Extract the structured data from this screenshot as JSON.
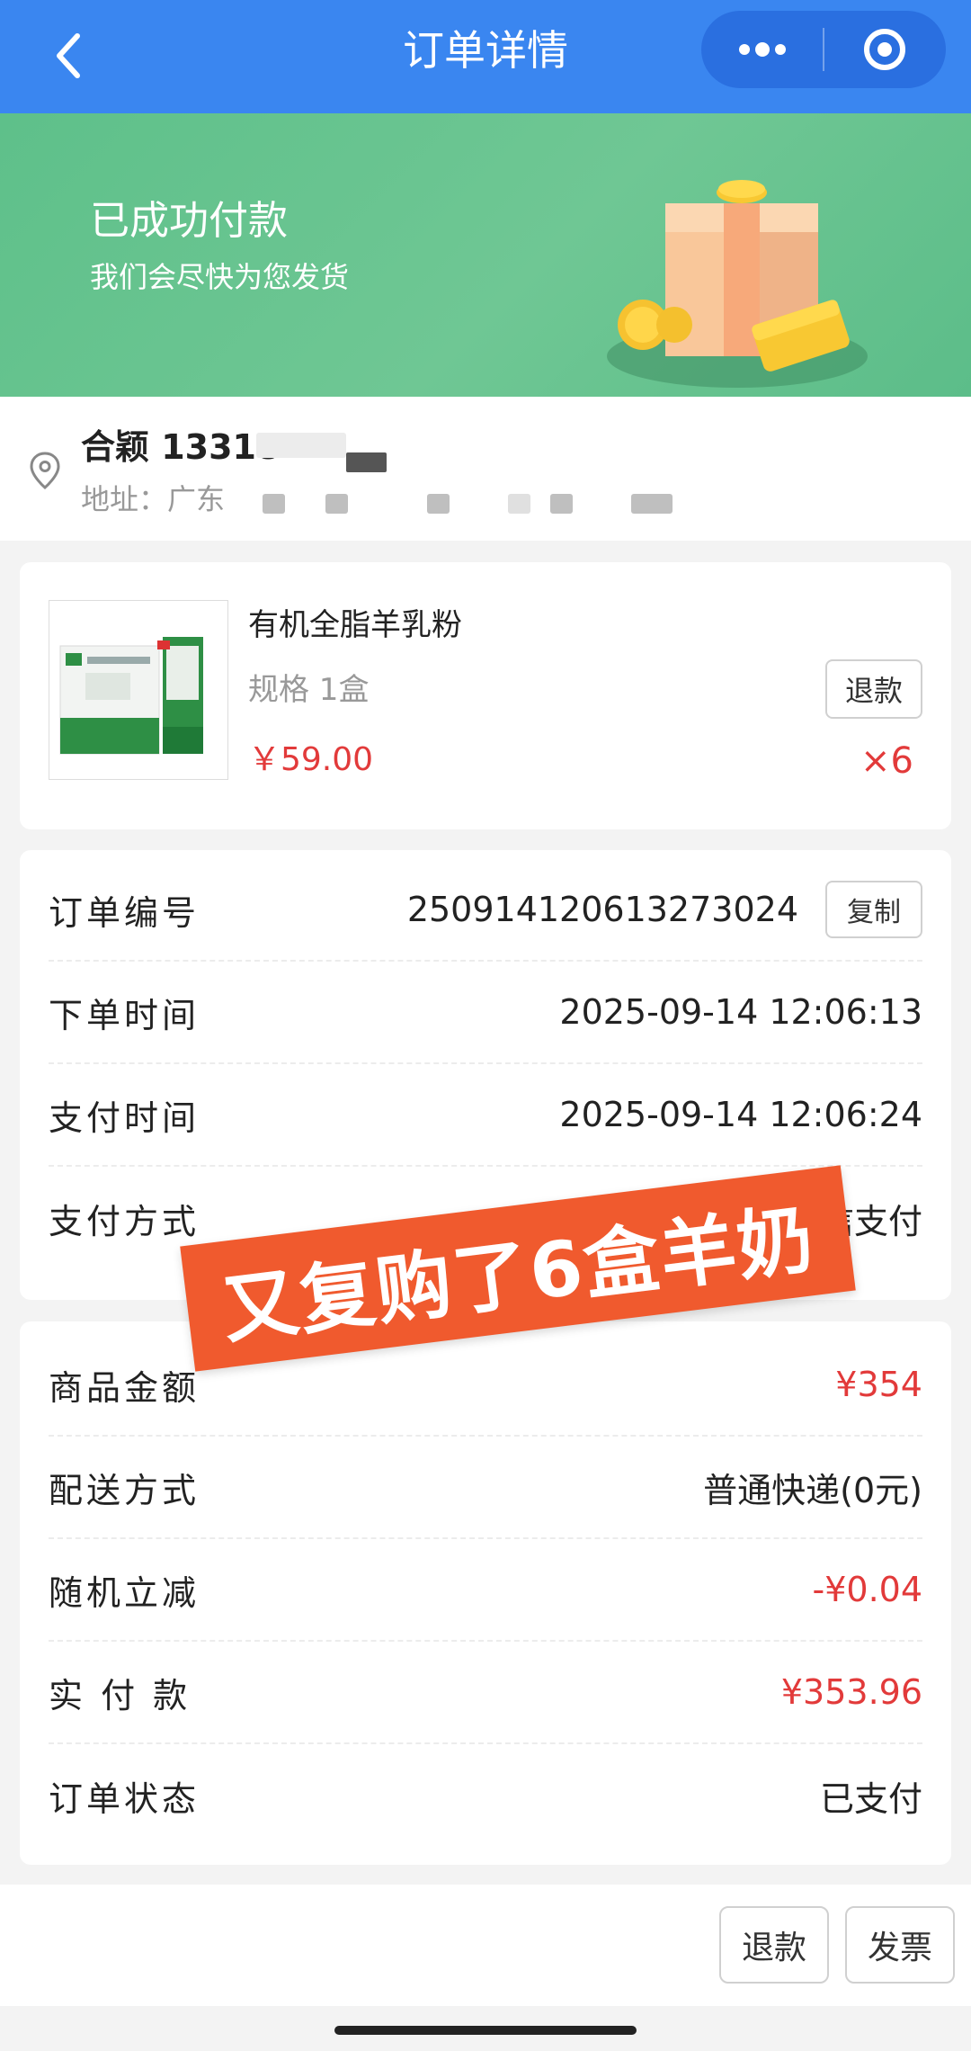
{
  "header": {
    "title": "订单详情"
  },
  "banner": {
    "title": "已成功付款",
    "subtitle": "我们会尽快为您发货"
  },
  "address": {
    "name": "合颖 13318",
    "line": "地址：广东"
  },
  "product": {
    "name": "有机全脂羊乳粉",
    "spec": "规格 1盒",
    "price": "￥59.00",
    "refund_label": "退款",
    "quantity": "×6"
  },
  "order_info": [
    {
      "label": "订单编号",
      "value": "250914120613273024",
      "action": "复制"
    },
    {
      "label": "下单时间",
      "value": "2025-09-14 12:06:13"
    },
    {
      "label": "支付时间",
      "value": "2025-09-14 12:06:24"
    },
    {
      "label": "支付方式",
      "value": "信支付"
    }
  ],
  "amounts": [
    {
      "label": "商品金额",
      "value": "¥354",
      "color": "#e23a3a"
    },
    {
      "label": "配送方式",
      "value": "普通快递(0元)"
    },
    {
      "label": "随机立减",
      "value": "-¥0.04",
      "color": "#e23a3a"
    },
    {
      "label": "实 付 款",
      "value": "¥353.96",
      "color": "#e23a3a"
    },
    {
      "label": "订单状态",
      "value": "已支付"
    }
  ],
  "overlay": {
    "text": "又复购了6盒羊奶"
  },
  "bottom": {
    "refund_label": "退款",
    "invoice_label": "发票"
  },
  "colors": {
    "header": "#3a86f0",
    "banner": "#6fc794",
    "price_red": "#e23a3a",
    "overlay": "#f05a2e"
  }
}
